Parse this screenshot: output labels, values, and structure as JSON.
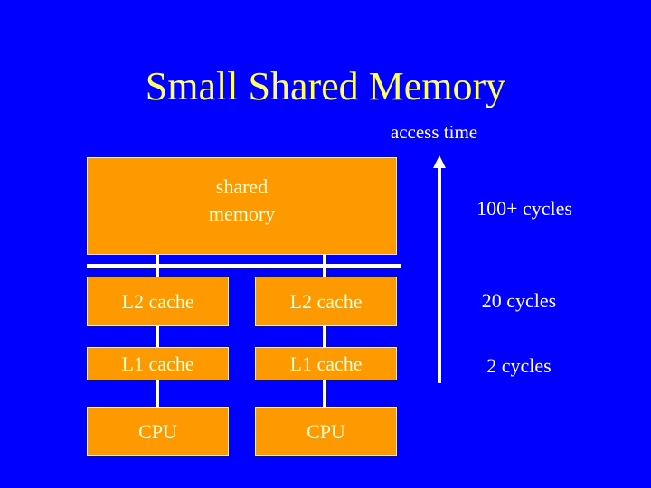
{
  "title": "Small Shared Memory",
  "access_time_label": "access time",
  "shared_memory_label": "shared memory",
  "columns": [
    {
      "l2": "L2 cache",
      "l1": "L1 cache",
      "cpu": "CPU"
    },
    {
      "l2": "L2 cache",
      "l1": "L1 cache",
      "cpu": "CPU"
    }
  ],
  "latencies": {
    "memory": "100+ cycles",
    "l2": "20 cycles",
    "l1": "2 cycles"
  },
  "colors": {
    "background": "#0000ff",
    "box_fill": "#ff9900",
    "title": "#ffff66",
    "box_text": "#ffffcc",
    "lines": "#ffffff"
  }
}
